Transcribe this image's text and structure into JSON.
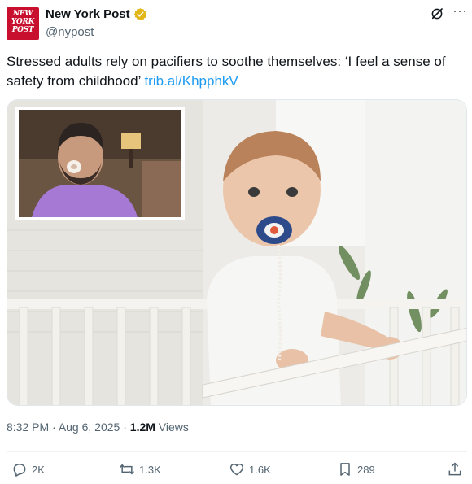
{
  "account": {
    "avatar_text": "NEW YORK POST",
    "display_name": "New York Post",
    "handle": "@nypost",
    "verified_badge_color": "#e2b719",
    "avatar_color": "#c8102e"
  },
  "header_icons": [
    "grok-icon",
    "more-icon"
  ],
  "tweet": {
    "text": "Stressed adults rely on pacifiers to soothe themselves: ‘I feel a sense of safety from childhood’ ",
    "link": "trib.al/KhpphkV"
  },
  "meta": {
    "time": "8:32 PM",
    "separator1": " · ",
    "date": "Aug 6, 2025",
    "separator2": " · ",
    "views_count": "1.2M",
    "views_label": " Views"
  },
  "actions": {
    "replies": "2K",
    "retweets": "1.3K",
    "likes": "1.6K",
    "bookmarks": "289"
  },
  "colors": {
    "link": "#1d9bf0",
    "secondary_text": "#536471",
    "primary_text": "#0f1419"
  }
}
